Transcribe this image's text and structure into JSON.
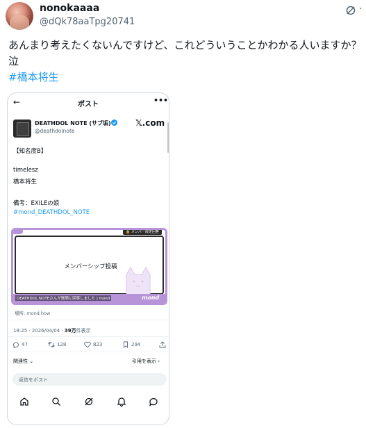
{
  "tweet": {
    "display_name": "nonokaaaa",
    "handle": "@dQk78aaTpg20741",
    "text": "あんまり考えたくないんですけど、これどういうことかわかる人いますか？泣",
    "hashtag": "#橋本将生",
    "more_label": "·"
  },
  "embedded": {
    "header": {
      "back": "←",
      "title": "ポスト",
      "more": "•••"
    },
    "account": {
      "name": "DEATHDOL NOTE (サブ垢)",
      "handle": "@deathdolnote",
      "site": "𝕏.com"
    },
    "body": {
      "line1": "【知名度B】",
      "line2": "timelesz",
      "line3": "橋本将生",
      "line4": "備考：EXILEの娘",
      "link": "#mond_DEATHDOL_NOTE"
    },
    "card": {
      "badge": "🔒 メンバー限定回答",
      "text": "メンバーシップ投稿",
      "caption": "DEATHDOL NOTEさんが質問に回答しました | mond",
      "logo": "mond"
    },
    "source": "場所: mond.how",
    "meta": {
      "time": "18:25 · 2026/04/04 · ",
      "views_count": "39万",
      "views_label": "件表示"
    },
    "stats": {
      "replies": "47",
      "retweets": "128",
      "likes": "823",
      "bookmarks": "294"
    },
    "relevance": "関連性 ⌄",
    "quotes": "引用を表示 ›",
    "reply_placeholder": "返信をポスト"
  },
  "colors": {
    "accent": "#1d9bf0",
    "card_border": "#b794d8",
    "text": "#0f1419",
    "muted": "#536471"
  }
}
